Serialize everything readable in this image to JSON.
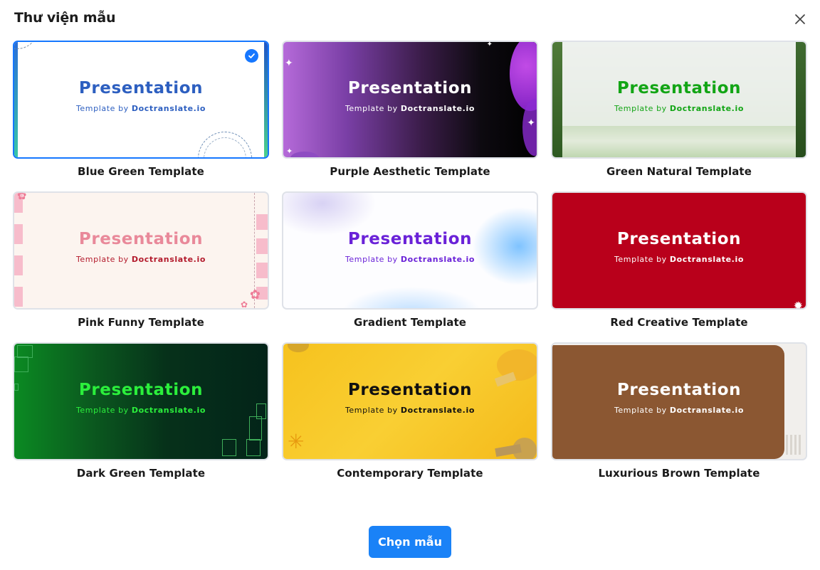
{
  "dialog": {
    "title": "Thư viện mẫu",
    "confirm_label": "Chọn mẫu"
  },
  "templates": [
    {
      "name": "Blue Green Template",
      "title": "Presentation",
      "sub_prefix": "Template by ",
      "sub_brand": "Doctranslate.io",
      "selected": true
    },
    {
      "name": "Purple Aesthetic Template",
      "title": "Presentation",
      "sub_prefix": "Template by ",
      "sub_brand": "Doctranslate.io"
    },
    {
      "name": "Green Natural Template",
      "title": "Presentation",
      "sub_prefix": "Template by ",
      "sub_brand": "Doctranslate.io"
    },
    {
      "name": "Pink Funny Template",
      "title": "Presentation",
      "sub_prefix": "Template by ",
      "sub_brand": "Doctranslate.io"
    },
    {
      "name": "Gradient Template",
      "title": "Presentation",
      "sub_prefix": "Template by ",
      "sub_brand": "Doctranslate.io"
    },
    {
      "name": "Red Creative Template",
      "title": "Presentation",
      "sub_prefix": "Template by ",
      "sub_brand": "Doctranslate.io"
    },
    {
      "name": "Dark Green Template",
      "title": "Presentation",
      "sub_prefix": "Template by ",
      "sub_brand": "Doctranslate.io"
    },
    {
      "name": "Contemporary Template",
      "title": "Presentation",
      "sub_prefix": "Template by ",
      "sub_brand": "Doctranslate.io"
    },
    {
      "name": "Luxurious Brown Template",
      "title": "Presentation",
      "sub_prefix": "Template by ",
      "sub_brand": "Doctranslate.io"
    }
  ],
  "icons": {
    "close": "close-icon",
    "selected": "check-circle-icon"
  },
  "colors": {
    "accent": "#1677ff",
    "button": "#1a82f7"
  }
}
